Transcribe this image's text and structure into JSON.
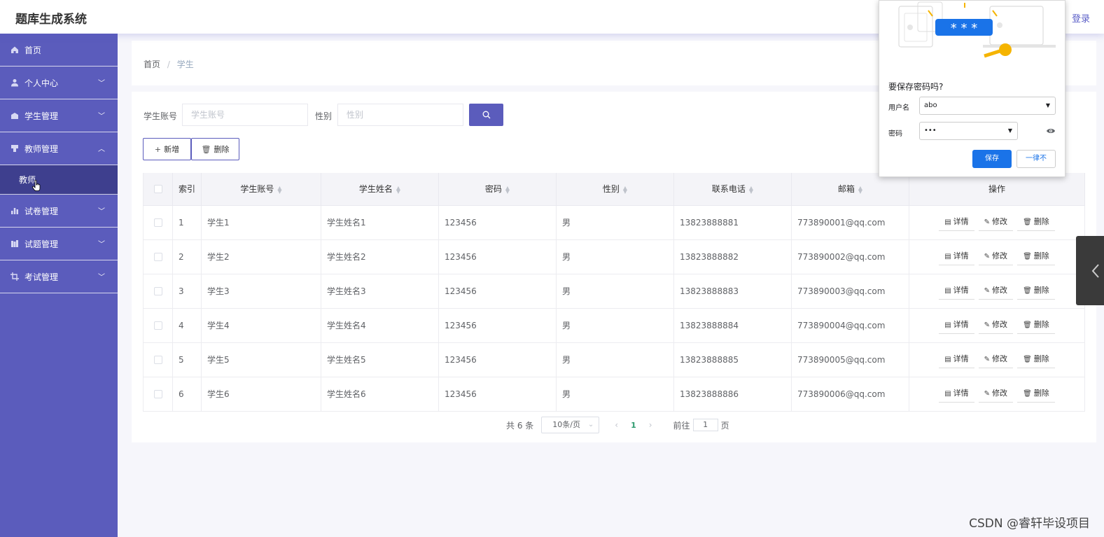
{
  "header": {
    "title": "题库生成系统",
    "logout": "登录"
  },
  "sidebar": {
    "items": [
      {
        "label": "首页",
        "icon": "home-icon",
        "chevron": ""
      },
      {
        "label": "个人中心",
        "icon": "user-icon",
        "chevron": "﹀"
      },
      {
        "label": "学生管理",
        "icon": "student-icon",
        "chevron": "﹀"
      },
      {
        "label": "教师管理",
        "icon": "teacher-icon",
        "chevron": "︿"
      },
      {
        "label": "试卷管理",
        "icon": "chart-icon",
        "chevron": "﹀"
      },
      {
        "label": "试题管理",
        "icon": "books-icon",
        "chevron": "﹀"
      },
      {
        "label": "考试管理",
        "icon": "crop-icon",
        "chevron": "﹀"
      }
    ],
    "submenu": {
      "label": "教师"
    }
  },
  "breadcrumb": {
    "home": "首页",
    "sep": "/",
    "current": "学生"
  },
  "search": {
    "account_label": "学生账号",
    "account_placeholder": "学生账号",
    "gender_label": "性别",
    "gender_placeholder": "性别"
  },
  "actions": {
    "add": "新增",
    "delete": "删除"
  },
  "table": {
    "columns": [
      "索引",
      "学生账号",
      "学生姓名",
      "密码",
      "性别",
      "联系电话",
      "邮箱",
      "操作"
    ],
    "op_labels": {
      "detail": "详情",
      "edit": "修改",
      "delete": "删除"
    },
    "rows": [
      {
        "index": "1",
        "account": "学生1",
        "name": "学生姓名1",
        "password": "123456",
        "gender": "男",
        "phone": "13823888881",
        "email": "773890001@qq.com"
      },
      {
        "index": "2",
        "account": "学生2",
        "name": "学生姓名2",
        "password": "123456",
        "gender": "男",
        "phone": "13823888882",
        "email": "773890002@qq.com"
      },
      {
        "index": "3",
        "account": "学生3",
        "name": "学生姓名3",
        "password": "123456",
        "gender": "男",
        "phone": "13823888883",
        "email": "773890003@qq.com"
      },
      {
        "index": "4",
        "account": "学生4",
        "name": "学生姓名4",
        "password": "123456",
        "gender": "男",
        "phone": "13823888884",
        "email": "773890004@qq.com"
      },
      {
        "index": "5",
        "account": "学生5",
        "name": "学生姓名5",
        "password": "123456",
        "gender": "男",
        "phone": "13823888885",
        "email": "773890005@qq.com"
      },
      {
        "index": "6",
        "account": "学生6",
        "name": "学生姓名6",
        "password": "123456",
        "gender": "男",
        "phone": "13823888886",
        "email": "773890006@qq.com"
      }
    ]
  },
  "pagination": {
    "total": "共 6 条",
    "page_size": "10条/页",
    "current": "1",
    "goto_prefix": "前往",
    "goto_value": "1",
    "goto_suffix": "页"
  },
  "password_popup": {
    "title": "要保存密码吗?",
    "username_label": "用户名",
    "username_value": "abo",
    "password_label": "密码",
    "password_value": "•••",
    "save": "保存",
    "never": "一律不",
    "illustration_text": "* * *"
  },
  "watermark": "CSDN @睿轩毕设项目",
  "colors": {
    "primary": "#5b5cbc",
    "sidebar_active": "#3e3f8e",
    "popup_blue": "#1a73e8"
  }
}
